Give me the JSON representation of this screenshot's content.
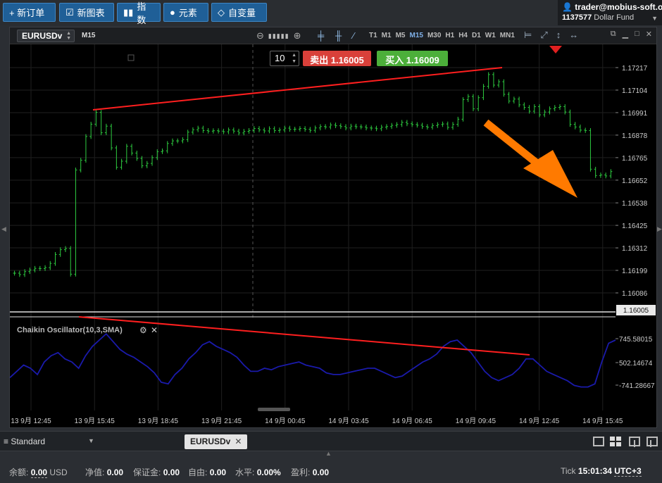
{
  "toolbar": {
    "new_order": "+ 新订单",
    "new_chart": "新图表",
    "indicators": "指数",
    "elements": "元素",
    "custom_vars": "自变量"
  },
  "account": {
    "user": "trader@mobius-soft.org",
    "number": "1137577",
    "fund": "Dollar Fund"
  },
  "chart": {
    "symbol": "EURUSDv",
    "timeframe": "M15",
    "timeframes": [
      "T1",
      "M1",
      "M5",
      "M15",
      "M30",
      "H1",
      "H4",
      "D1",
      "W1",
      "MN1"
    ],
    "active_timeframe": "M15",
    "lot": "10",
    "sell_label": "卖出 1.16005",
    "buy_label": "买入 1.16009",
    "current_price": "1.16005",
    "indicator_label": "Chaikin Oscillator(10,3,SMA)",
    "price_ticks": [
      "1.17217",
      "1.17104",
      "1.16991",
      "1.16878",
      "1.16765",
      "1.16652",
      "1.16538",
      "1.16425",
      "1.16312",
      "1.16199",
      "1.16086"
    ],
    "osc_ticks": [
      "745.58015",
      "502.14674",
      "-741.28667"
    ],
    "time_ticks": [
      "13 9月 12:45",
      "13 9月 15:45",
      "13 9月 18:45",
      "13 9月 21:45",
      "14 9月 00:45",
      "14 9月 03:45",
      "14 9月 06:45",
      "14 9月 09:45",
      "14 9月 12:45",
      "14 9月 15:45"
    ],
    "colors": {
      "bull": "#2ecc40",
      "bear": "#2ecc40",
      "trend": "#ff1f1f",
      "arrow": "#ff7a00",
      "osc": "#1a1aaa",
      "sell": "#d9403a",
      "buy": "#4caf3a"
    }
  },
  "chart_data": {
    "type": "line",
    "series": [
      {
        "values": [
          1.16185,
          1.16178,
          1.16193,
          1.16201,
          1.16209,
          1.16208,
          1.16213,
          1.16234,
          1.16279,
          1.16303,
          1.16309,
          1.1618,
          1.16703,
          1.16752,
          1.16871,
          1.16933,
          1.16992,
          1.1689,
          1.16923,
          1.16814,
          1.16717,
          1.16747,
          1.16822,
          1.16788,
          1.16761,
          1.16724,
          1.16736,
          1.16765,
          1.16795,
          1.16799,
          1.16836,
          1.16849,
          1.16849,
          1.16855,
          1.16893,
          1.16905,
          1.16913,
          1.16901,
          1.16898,
          1.169,
          1.16898,
          1.16895,
          1.16904,
          1.16898,
          1.16889,
          1.16897,
          1.16901,
          1.16911,
          1.16904,
          1.16899,
          1.1691,
          1.16901,
          1.16904,
          1.16913,
          1.16907,
          1.16908,
          1.16911,
          1.16907,
          1.16902,
          1.16914,
          1.16921,
          1.16919,
          1.16929,
          1.16925,
          1.16921,
          1.16914,
          1.16923,
          1.1692,
          1.16919,
          1.16914,
          1.16913,
          1.1691,
          1.16918,
          1.16921,
          1.16927,
          1.16931,
          1.16942,
          1.16935,
          1.16931,
          1.16928,
          1.16921,
          1.16918,
          1.16926,
          1.16931,
          1.16934,
          1.16917,
          1.16932,
          1.16958,
          1.17056,
          1.17072,
          1.1701,
          1.17066,
          1.17123,
          1.17182,
          1.17129,
          1.17146,
          1.17083,
          1.17049,
          1.17059,
          1.1703,
          1.17017,
          1.16998,
          1.17021,
          1.1698,
          1.16994,
          1.1701,
          1.17017,
          1.17021,
          1.16994,
          1.16932,
          1.16919,
          1.16903,
          1.16901,
          1.16707,
          1.16675,
          1.16678,
          1.16673,
          1.16695
        ]
      },
      {
        "values": [
          -500,
          -300,
          -100,
          -200,
          -400,
          0,
          200,
          300,
          100,
          0,
          -200,
          200,
          500,
          700,
          900,
          650,
          400,
          250,
          150,
          0,
          -150,
          -350,
          -650,
          -700,
          -400,
          -200,
          100,
          300,
          550,
          650,
          500,
          400,
          300,
          150,
          -100,
          -300,
          -300,
          -200,
          -250,
          -150,
          -100,
          -50,
          0,
          -100,
          -150,
          -200,
          -350,
          -400,
          -400,
          -350,
          -300,
          -250,
          -200,
          -200,
          -300,
          -400,
          -500,
          -450,
          -300,
          -150,
          0,
          100,
          250,
          500,
          650,
          700,
          500,
          300,
          0,
          -300,
          -500,
          -600,
          -500,
          -400,
          -200,
          100,
          100,
          -100,
          -300,
          -400,
          -500,
          -600,
          -750,
          -800,
          -800,
          -700,
          0,
          600,
          700
        ]
      }
    ]
  },
  "tabs": {
    "layout_name": "≡ Standard",
    "active_tab": "EURUSDv"
  },
  "status": {
    "balance_label": "余额:",
    "balance_value": "0.00",
    "balance_ccy": "USD",
    "equity_label": "净值:",
    "equity_value": "0.00",
    "margin_label": "保证金:",
    "margin_value": "0.00",
    "free_label": "自由:",
    "free_value": "0.00",
    "level_label": "水平:",
    "level_value": "0.00%",
    "profit_label": "盈利:",
    "profit_value": "0.00",
    "tick_label": "Tick",
    "tick_time": "15:01:34",
    "tz": "UTC+3"
  }
}
